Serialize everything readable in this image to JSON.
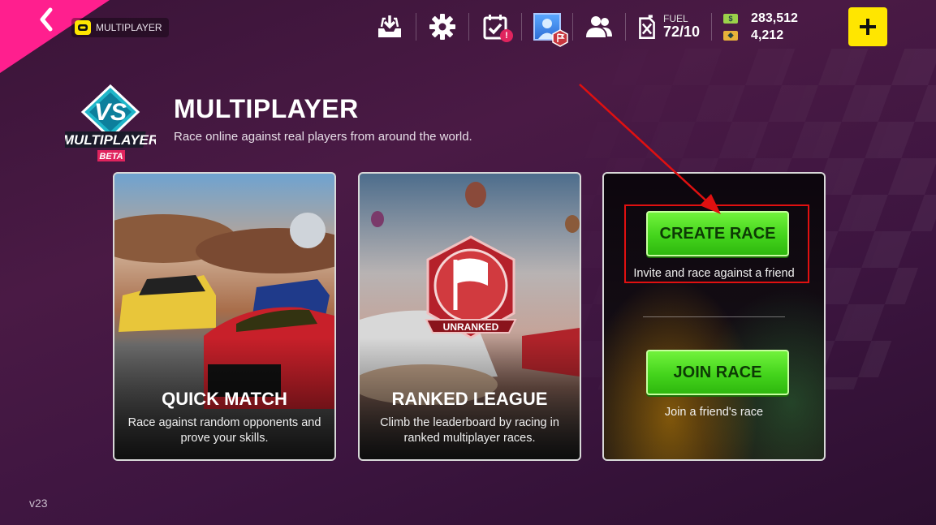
{
  "header": {
    "mode_label": "MULTIPLAYER",
    "fuel_label": "FUEL",
    "fuel_value": "72/10",
    "cash": "283,512",
    "tokens": "4,212",
    "notification_badge": "!"
  },
  "page": {
    "title": "MULTIPLAYER",
    "subtitle": "Race online against real players from around the world.",
    "logo_text": "MULTIPLAYER",
    "logo_vs": "VS",
    "logo_beta": "BETA"
  },
  "cards": {
    "quick_match": {
      "title": "QUICK MATCH",
      "description": "Race against random opponents and prove your skills."
    },
    "ranked_league": {
      "title": "RANKED LEAGUE",
      "description": "Climb the leaderboard by racing in ranked multiplayer races.",
      "emblem_label": "UNRANKED"
    },
    "private": {
      "create_label": "CREATE RACE",
      "create_caption": "Invite and race against a friend",
      "join_label": "JOIN RACE",
      "join_caption": "Join a friend's race"
    }
  },
  "footer": {
    "version": "v23"
  },
  "colors": {
    "accent_yellow": "#ffe600",
    "accent_pink": "#ff1f8e",
    "button_green": "#44d41c",
    "highlight_red": "#e01010"
  }
}
